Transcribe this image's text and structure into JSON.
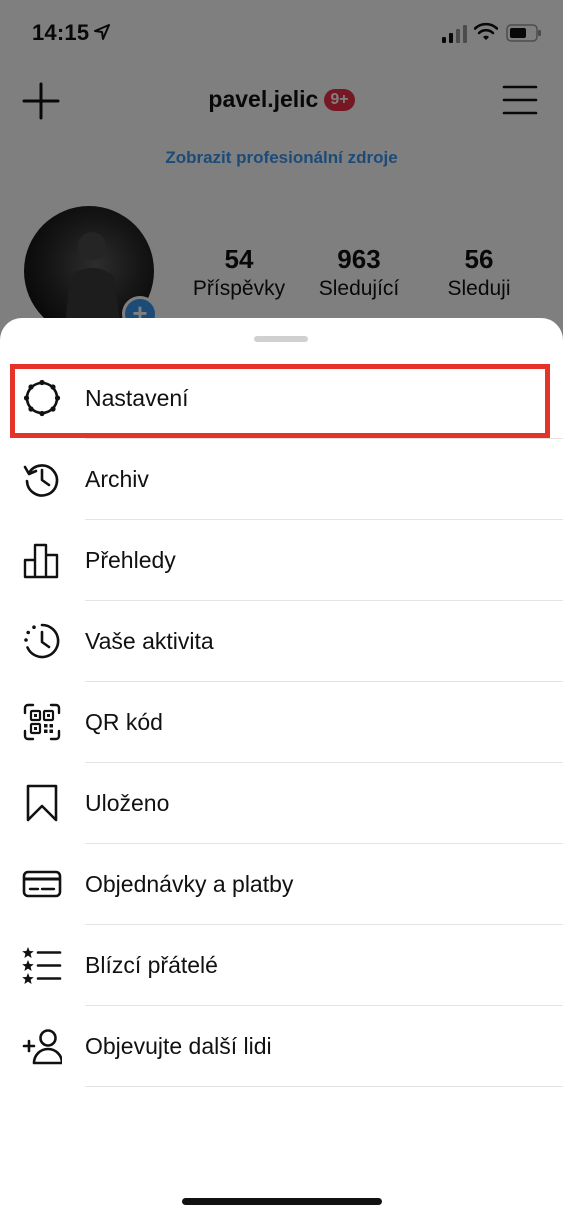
{
  "status_bar": {
    "time": "14:15"
  },
  "header": {
    "username": "pavel.jelic",
    "notification_badge": "9+"
  },
  "profile": {
    "pro_link": "Zobrazit profesionální zdroje",
    "stats": [
      {
        "value": "54",
        "label": "Příspěvky"
      },
      {
        "value": "963",
        "label": "Sledující"
      },
      {
        "value": "56",
        "label": "Sleduji"
      }
    ]
  },
  "menu": {
    "items": [
      {
        "label": "Nastavení",
        "icon": "settings-gear-icon",
        "highlighted": true
      },
      {
        "label": "Archiv",
        "icon": "archive-history-icon"
      },
      {
        "label": "Přehledy",
        "icon": "insights-bar-chart-icon"
      },
      {
        "label": "Vaše aktivita",
        "icon": "activity-clock-icon"
      },
      {
        "label": "QR kód",
        "icon": "qr-code-icon"
      },
      {
        "label": "Uloženo",
        "icon": "bookmark-icon"
      },
      {
        "label": "Objednávky a platby",
        "icon": "credit-card-icon"
      },
      {
        "label": "Blízcí přátelé",
        "icon": "close-friends-list-icon"
      },
      {
        "label": "Objevujte další lidi",
        "icon": "add-person-icon"
      }
    ]
  },
  "colors": {
    "highlight": "#e5332a",
    "link": "#3897f0",
    "badge": "#ed2f48"
  }
}
